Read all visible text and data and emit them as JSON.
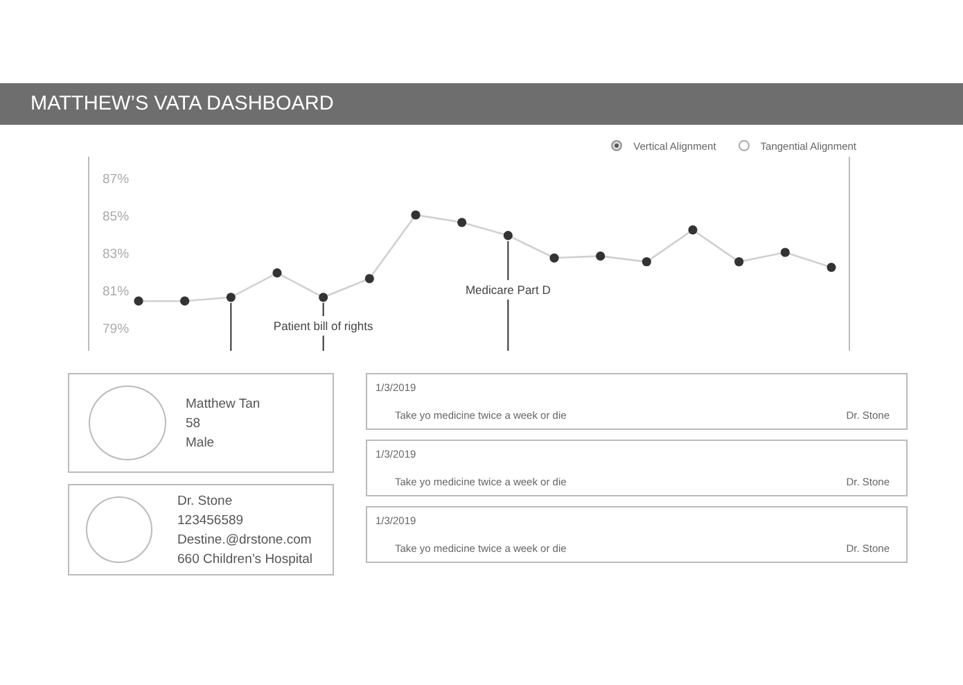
{
  "header": {
    "title": "MATTHEW’S VATA DASHBOARD"
  },
  "alignment_options": [
    {
      "label": "Vertical Alignment",
      "selected": true
    },
    {
      "label": "Tangential Alignment",
      "selected": false
    }
  ],
  "chart": {
    "chart_data": {
      "type": "line",
      "ylim": [
        79,
        87
      ],
      "yticks": [
        {
          "value": 79,
          "label": "79%"
        },
        {
          "value": 81,
          "label": "81%"
        },
        {
          "value": 83,
          "label": "83%"
        },
        {
          "value": 85,
          "label": "85%"
        },
        {
          "value": 87,
          "label": "87%"
        }
      ],
      "series": [
        {
          "color": "#d0d0d0",
          "marker": "circle",
          "values": [
            80.4,
            80.4,
            80.6,
            81.9,
            80.6,
            81.6,
            85.0,
            84.6,
            83.9,
            82.7,
            82.8,
            82.5,
            84.2,
            82.5,
            83.0,
            82.2
          ]
        }
      ],
      "annotations": [
        "Patient bill of rights",
        "Medicare Part D"
      ]
    }
  },
  "patient": {
    "name": "Matthew Tan",
    "age": "58",
    "sex": "Male"
  },
  "doctor": {
    "name": "Dr. Stone",
    "phone": "123456589",
    "email": "Destine.@drstone.com",
    "address": "660 Children’s Hospital"
  },
  "notes": [
    {
      "date": "1/3/2019",
      "text": "Take yo medicine twice a week or die",
      "author": "Dr. Stone"
    },
    {
      "date": "1/3/2019",
      "text": "Take yo medicine twice a week or die",
      "author": "Dr. Stone"
    },
    {
      "date": "1/3/2019",
      "text": "Take yo medicine twice a week or die",
      "author": "Dr. Stone"
    }
  ]
}
